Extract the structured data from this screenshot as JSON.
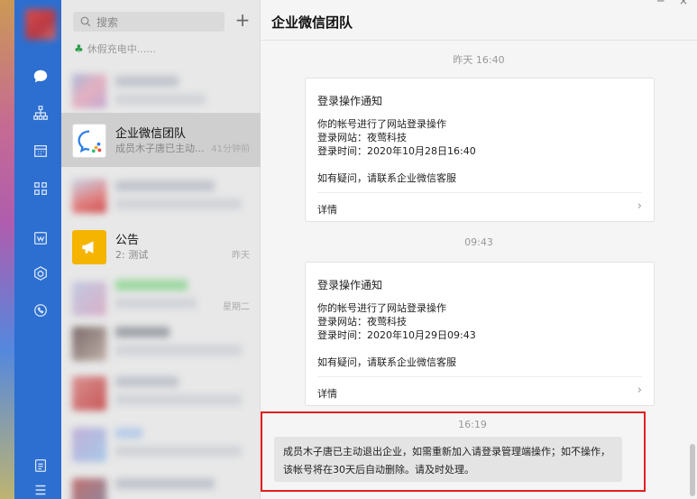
{
  "sidebar": {
    "icons": [
      "chat-icon",
      "org-chart-icon",
      "calendar-icon",
      "apps-grid-icon",
      "doc-icon",
      "cube-icon",
      "phone-icon",
      "files-icon",
      "menu-icon"
    ]
  },
  "list": {
    "search_placeholder": "搜索",
    "add_label": "+",
    "status_text": "休假充电中......",
    "conversations": [
      {
        "name": "企业微信团队",
        "preview": "成员木子唐已主动...",
        "time": "41分钟前"
      },
      {
        "name": "公告",
        "preview": "2: 测试",
        "time": "昨天"
      },
      {
        "time": "星期二"
      }
    ]
  },
  "main": {
    "title": "企业微信团队",
    "window_controls": [
      "─",
      "×"
    ],
    "messages": [
      {
        "timestamp": "昨天 16:40",
        "card_title": "登录操作通知",
        "lines": [
          "你的帐号进行了网站登录操作",
          "登录网站：夜莺科技",
          "登录时间：2020年10月28日16:40"
        ],
        "help": "如有疑问，请联系企业微信客服",
        "detail": "详情"
      },
      {
        "timestamp": "09:43",
        "card_title": "登录操作通知",
        "lines": [
          "你的帐号进行了网站登录操作",
          "登录网站：夜莺科技",
          "登录时间：2020年10月29日09:43"
        ],
        "help": "如有疑问，请联系企业微信客服",
        "detail": "详情"
      }
    ],
    "notice": {
      "timestamp": "16:19",
      "text": "成员木子唐已主动退出企业，如需重新加入请登录管理端操作；如不操作，该帐号将在30天后自动删除。请及时处理。"
    }
  },
  "colors": {
    "rail": "#2c6fd0",
    "highlight": "#e02020",
    "announce": "#f5b400"
  }
}
